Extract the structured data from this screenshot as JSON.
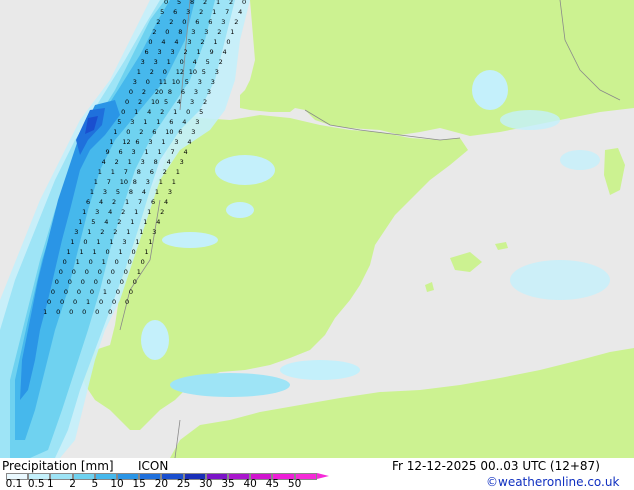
{
  "legend": {
    "title": "Precipitation [mm]",
    "model": "ICON",
    "datetime": "Fr 12-12-2025 00..03 UTC (12+87)",
    "credit": "©weatheronline.co.uk",
    "ticks": [
      "0.1",
      "0.5",
      "1",
      "2",
      "5",
      "10",
      "15",
      "20",
      "25",
      "30",
      "35",
      "40",
      "45",
      "50"
    ],
    "colors": [
      "#eaf9ff",
      "#c4f0fb",
      "#9ee4f6",
      "#6fd2f0",
      "#46b8ec",
      "#2a95e6",
      "#1f70dc",
      "#1a4fcf",
      "#1a2fb8",
      "#7b14c8",
      "#a916cd",
      "#d014cf",
      "#ee1ed8",
      "#f52ad8"
    ]
  },
  "map": {
    "colors": {
      "sea": "#e9e9e9",
      "land": "#ccf291",
      "border": "#8a8a8a"
    },
    "labels": [
      "0",
      "5",
      "8",
      "2",
      "1",
      "2",
      "0",
      "5",
      "6",
      "3",
      "2",
      "1",
      "7",
      "4",
      "2",
      "2",
      "0",
      "6",
      "6",
      "3",
      "2",
      "2",
      "0",
      "8",
      "3",
      "3",
      "2",
      "1",
      "0",
      "4",
      "4",
      "3",
      "2",
      "1",
      "0",
      "6",
      "3",
      "3",
      "2",
      "1",
      "9",
      "4",
      "3",
      "3",
      "1",
      "0",
      "4",
      "5",
      "2",
      "1",
      "2",
      "0",
      "12",
      "10",
      "5",
      "3",
      "3",
      "0",
      "11",
      "10",
      "5",
      "3",
      "3",
      "0",
      "2",
      "20",
      "8",
      "6",
      "3",
      "3",
      "0",
      "2",
      "10",
      "5",
      "4",
      "3",
      "2",
      "0",
      "1",
      "4",
      "2",
      "1",
      "0",
      "5",
      "5",
      "3",
      "1",
      "1",
      "6",
      "4",
      "3",
      "1",
      "0",
      "2",
      "6",
      "10",
      "6",
      "3",
      "1",
      "12",
      "6",
      "3",
      "1",
      "3",
      "4",
      "9",
      "6",
      "3",
      "1",
      "1",
      "7",
      "4",
      "4",
      "2",
      "1",
      "3",
      "8",
      "4",
      "3",
      "1",
      "1",
      "7",
      "8",
      "6",
      "2",
      "1",
      "1",
      "7",
      "10",
      "8",
      "3",
      "1",
      "1",
      "1",
      "3",
      "5",
      "8",
      "4",
      "1",
      "3",
      "6",
      "4",
      "2",
      "1",
      "7",
      "6",
      "4",
      "1",
      "3",
      "4",
      "2",
      "1",
      "1",
      "2",
      "1",
      "5",
      "4",
      "2",
      "1",
      "1",
      "4",
      "3",
      "1",
      "2",
      "2",
      "1",
      "1",
      "3",
      "1",
      "0",
      "1",
      "1",
      "3",
      "1",
      "1",
      "1",
      "1",
      "1",
      "0",
      "1",
      "0",
      "1",
      "0",
      "1",
      "0",
      "1",
      "0",
      "0",
      "0",
      "0",
      "0",
      "0",
      "0",
      "0",
      "0",
      "1",
      "0",
      "0",
      "0",
      "0",
      "0",
      "0",
      "0",
      "0",
      "0",
      "0",
      "0",
      "1",
      "0",
      "0",
      "0",
      "0",
      "0",
      "1",
      "0",
      "0",
      "0",
      "1",
      "0",
      "0",
      "0",
      "0",
      "0"
    ]
  }
}
